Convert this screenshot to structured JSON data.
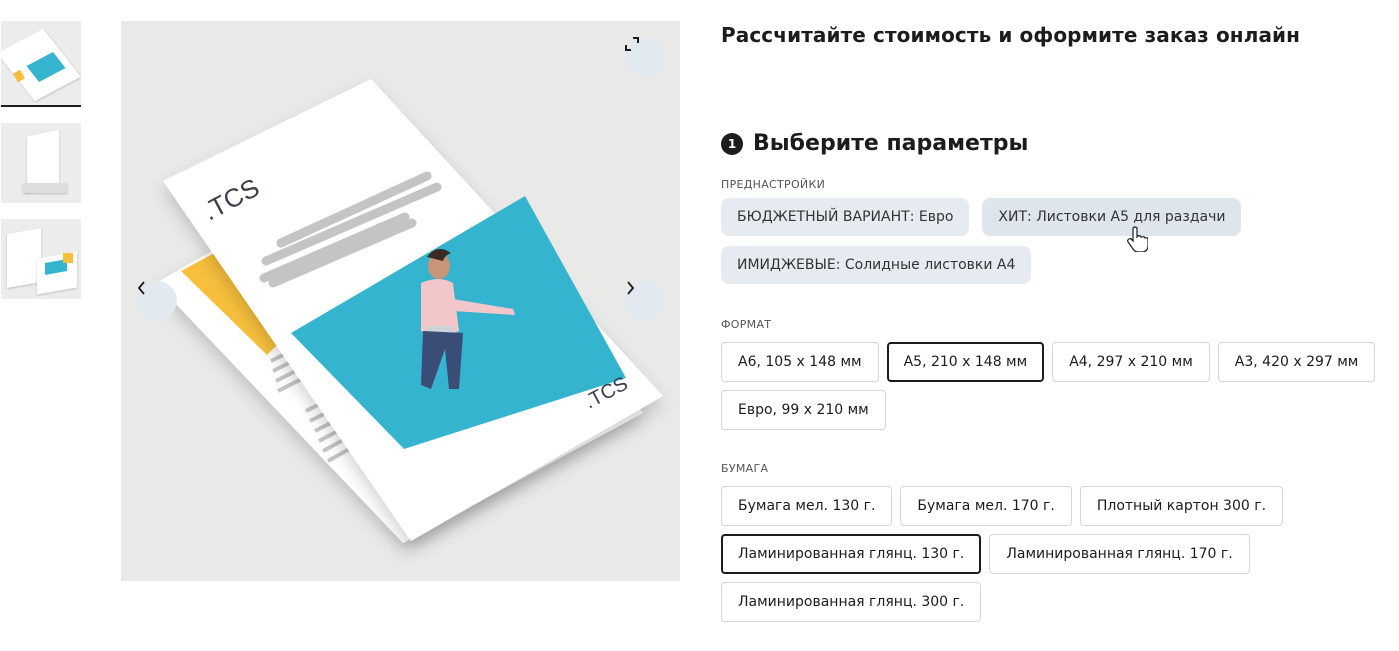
{
  "gallery": {
    "thumbnails": [
      {
        "name": "leaflets-flat",
        "active": true
      },
      {
        "name": "leaflet-on-stand",
        "active": false
      },
      {
        "name": "leaflets-stack",
        "active": false
      }
    ],
    "logo_text": ".TCS",
    "icons": {
      "expand": "expand-icon",
      "prev": "chevron-left-icon",
      "next": "chevron-right-icon"
    }
  },
  "header": {
    "title": "Рассчитайте стоимость и оформите заказ онлайн"
  },
  "step": {
    "number": "1",
    "title": "Выберите параметры"
  },
  "presets": {
    "label": "ПРЕДНАСТРОЙКИ",
    "items": [
      {
        "label": "БЮДЖЕТНЫЙ ВАРИАНТ: Евро"
      },
      {
        "label": "ХИТ: Листовки А5 для раздачи"
      },
      {
        "label": "ИМИДЖЕВЫЕ: Солидные листовки А4"
      }
    ]
  },
  "format": {
    "label": "ФОРМАТ",
    "items": [
      {
        "label": "А6, 105 х 148 мм",
        "selected": false
      },
      {
        "label": "А5, 210 х 148 мм",
        "selected": true
      },
      {
        "label": "А4, 297 х 210 мм",
        "selected": false
      },
      {
        "label": "А3, 420 х 297 мм",
        "selected": false
      },
      {
        "label": "Евро, 99 х 210 мм",
        "selected": false
      }
    ]
  },
  "paper": {
    "label": "БУМАГА",
    "items": [
      {
        "label": "Бумага мел. 130 г.",
        "selected": false
      },
      {
        "label": "Бумага мел. 170 г.",
        "selected": false
      },
      {
        "label": "Плотный картон 300 г.",
        "selected": false
      },
      {
        "label": "Ламинированная глянц. 130 г.",
        "selected": true
      },
      {
        "label": "Ламинированная глянц. 170 г.",
        "selected": false
      },
      {
        "label": "Ламинированная глянц. 300 г.",
        "selected": false
      }
    ]
  },
  "colors": {
    "accent_blue": "#35b4cf",
    "accent_yellow": "#f7bf3c",
    "chip_bg": "#e6ebf1",
    "text": "#1c1c1c"
  }
}
